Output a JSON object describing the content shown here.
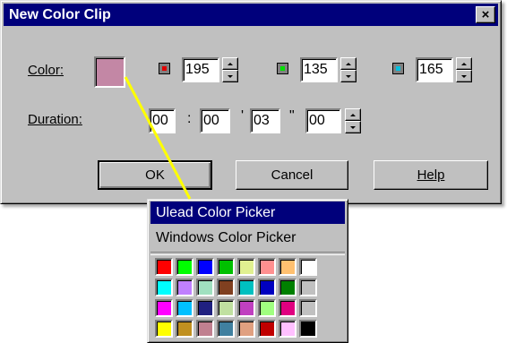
{
  "dialog": {
    "title": "New Color Clip",
    "close_glyph": "×"
  },
  "color_row": {
    "label": "Color:",
    "swatch_color": "#c387a5",
    "channels": [
      {
        "name": "red",
        "icon": "red-channel-icon",
        "icon_color": "#e00000",
        "value": "195"
      },
      {
        "name": "green",
        "icon": "green-channel-icon",
        "icon_color": "#00e000",
        "value": "135"
      },
      {
        "name": "blue",
        "icon": "blue-channel-icon",
        "icon_color": "#00c0e0",
        "value": "165"
      }
    ]
  },
  "duration_row": {
    "label": "Duration:",
    "fields": [
      "00",
      "00",
      "03",
      "00"
    ],
    "separators": [
      ":",
      "'",
      "\""
    ]
  },
  "buttons": {
    "ok": "OK",
    "cancel": "Cancel",
    "help": "Help"
  },
  "menu": {
    "items": [
      {
        "label": "Ulead Color Picker",
        "highlighted": true
      },
      {
        "label": "Windows Color Picker",
        "highlighted": false
      }
    ],
    "palette": [
      "#ff0000",
      "#00ff00",
      "#0000ff",
      "#00c000",
      "#e0f090",
      "#ff9090",
      "#ffc070",
      "#ffffff",
      "#00ffff",
      "#c080ff",
      "#a0e0c0",
      "#804020",
      "#00c0c0",
      "#0000c0",
      "#008000",
      "#c0c0c0",
      "#ff00ff",
      "#00c0ff",
      "#202080",
      "#c0e0a0",
      "#c040c0",
      "#a0ff80",
      "#e00080",
      "#c0c0c0",
      "#ffff00",
      "#c09020",
      "#c08090",
      "#4080a0",
      "#e0a080",
      "#c00000",
      "#ffc0ff",
      "#000000"
    ]
  },
  "pointer_color": "#ffff00"
}
